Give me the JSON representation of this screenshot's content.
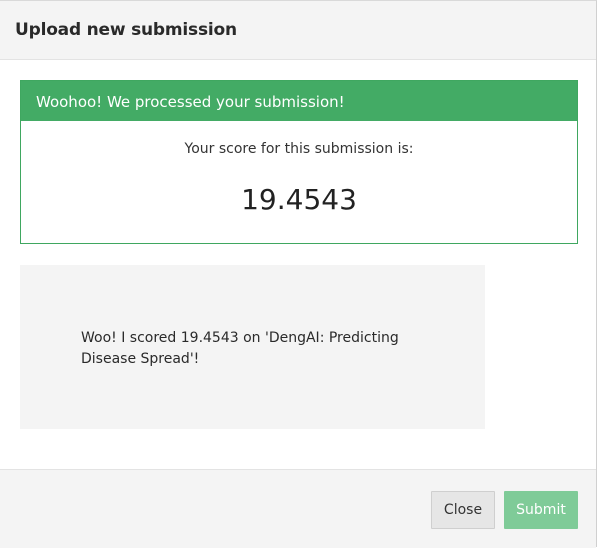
{
  "modal": {
    "title": "Upload new submission"
  },
  "result": {
    "success_message": "Woohoo! We processed your submission!",
    "score_label": "Your score for this submission is:",
    "score_value": "19.4543"
  },
  "share": {
    "text": "Woo! I scored 19.4543 on 'DengAI: Predicting Disease Spread'!"
  },
  "footer": {
    "close_label": "Close",
    "submit_label": "Submit"
  },
  "colors": {
    "success_green": "#43ab65",
    "submit_disabled_green": "#7fcb98",
    "header_gray": "#f4f4f4"
  }
}
